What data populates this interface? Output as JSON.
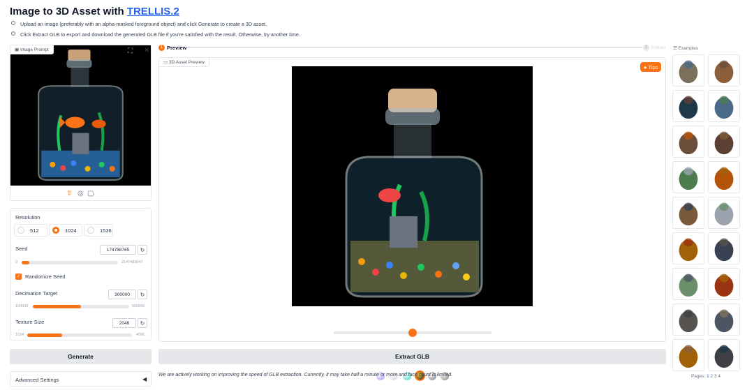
{
  "header": {
    "title_prefix": "Image to 3D Asset with ",
    "title_link": "TRELLIS.2"
  },
  "instructions": [
    "Upload an image (preferably with an alpha-masked foreground object) and click Generate to create a 3D asset.",
    "Click Extract GLB to export and download the generated GLB file if you're satisfied with the result. Otherwise, try another time."
  ],
  "image_prompt": {
    "label": "Image Prompt"
  },
  "settings": {
    "resolution_label": "Resolution",
    "resolution_options": [
      "512",
      "1024",
      "1536"
    ],
    "resolution_selected": "1024",
    "seed_label": "Seed",
    "seed_value": "174788765",
    "seed_min": "0",
    "seed_max": "2147483647",
    "seed_fraction": 0.08,
    "randomize_label": "Randomize Seed",
    "randomize_checked": true,
    "decimation_label": "Decimation Target",
    "decimation_value": "300000",
    "decimation_min": "100000",
    "decimation_max": "500000",
    "decimation_fraction": 0.5,
    "texture_label": "Texture Size",
    "texture_value": "2048",
    "texture_min": "1024",
    "texture_max": "4096",
    "texture_fraction": 0.33
  },
  "buttons": {
    "generate": "Generate",
    "extract": "Extract GLB"
  },
  "advanced": {
    "label": "Advanced Settings"
  },
  "steps": {
    "step1_num": "1",
    "step1": "Preview",
    "step2_num": "2",
    "step2": "Extract"
  },
  "preview": {
    "label": "3D Asset Preview",
    "tips": "Tips",
    "light_slider": 0.5
  },
  "notice": "We are actively working on improving the speed of GLB extraction. Currently, it may take half a minute or more and face count is limited.",
  "examples": {
    "label": "Examples",
    "pages_label": "Pages:",
    "pages": [
      "1",
      "2",
      "3",
      "4"
    ],
    "items": [
      "motorcycle-rider",
      "wooden-house",
      "bottle-aquarium",
      "tank-robot",
      "ornate-chair",
      "pirate-ship",
      "grass-plant",
      "flower-pot",
      "wagon",
      "gargoyle",
      "blaster-gun",
      "armor",
      "seaweed-plant",
      "warrior-figure",
      "bust-statue",
      "stone-ruins",
      "goblin",
      "dragon-statue"
    ]
  },
  "colors": {
    "accent": "#f97316",
    "link": "#2563eb"
  }
}
